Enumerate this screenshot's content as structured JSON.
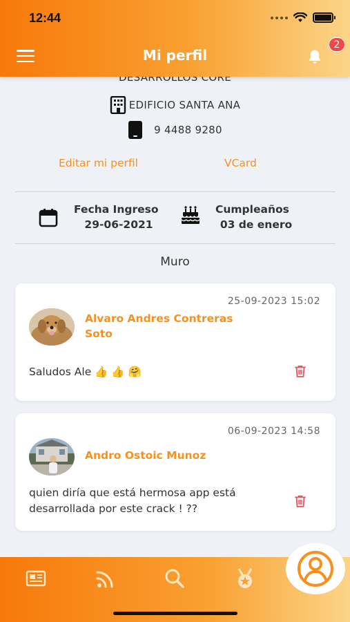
{
  "status_bar": {
    "time": "12:44"
  },
  "header": {
    "title": "Mi perfil",
    "notification_count": "2"
  },
  "profile": {
    "department": "DESARROLLOS CORE",
    "building": "EDIFICIO SANTA ANA",
    "phone": "9 4488 9280",
    "edit_link": "Editar mi perfil",
    "vcard_link": "VCard",
    "fecha_ingreso_label": "Fecha Ingreso",
    "fecha_ingreso_value": "29-06-2021",
    "cumpleanos_label": "Cumpleaños",
    "cumpleanos_value": "03 de enero"
  },
  "wall": {
    "title": "Muro",
    "posts": [
      {
        "date": "25-09-2023 15:02",
        "author_line1": "Alvaro Andres Contreras",
        "author_line2": "Soto",
        "message": "Saludos Ale 👍 👍  🤗",
        "avatar": "dog-photo"
      },
      {
        "date": "06-09-2023 14:58",
        "author_line1": "Andro Ostoic Munoz",
        "message_line1": "quien diría que está hermosa app está",
        "message_line2": "desarrollada por este crack ! ??",
        "avatar": "person-outdoor-photo"
      }
    ]
  },
  "bottom_nav": {
    "items": [
      "news-icon",
      "rss-icon",
      "search-icon",
      "medal-icon",
      "profile-icon"
    ]
  },
  "colors": {
    "accent": "#f7901e",
    "header_start": "#f7790a",
    "header_end": "#fbd588",
    "danger": "#e8505b"
  }
}
